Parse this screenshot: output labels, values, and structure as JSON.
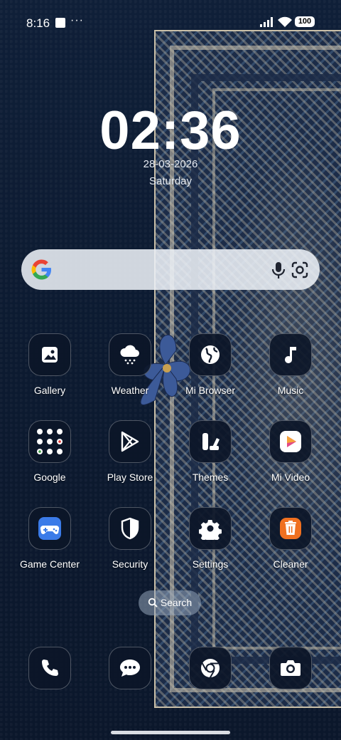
{
  "status_bar": {
    "time": "8:16",
    "more": "···",
    "battery": "100"
  },
  "clock": {
    "time": "02:36",
    "date": "28-03-2026",
    "day": "Saturday"
  },
  "search_widget": {
    "icons": [
      "google-g-icon",
      "microphone-icon",
      "google-lens-icon"
    ]
  },
  "apps": [
    {
      "label": "Gallery",
      "icon": "gallery-icon"
    },
    {
      "label": "Weather",
      "icon": "weather-icon"
    },
    {
      "label": "Mi Browser",
      "icon": "globe-icon"
    },
    {
      "label": "Music",
      "icon": "music-note-icon"
    },
    {
      "label": "Google",
      "icon": "folder-icon"
    },
    {
      "label": "Play Store",
      "icon": "play-store-icon"
    },
    {
      "label": "Themes",
      "icon": "themes-icon"
    },
    {
      "label": "Mi Video",
      "icon": "video-play-icon"
    },
    {
      "label": "Game Center",
      "icon": "gamepad-icon"
    },
    {
      "label": "Security",
      "icon": "shield-icon"
    },
    {
      "label": "Settings",
      "icon": "gear-icon"
    },
    {
      "label": "Cleaner",
      "icon": "trash-icon"
    }
  ],
  "app_search_label": "Search",
  "dock": [
    {
      "icon": "phone-icon"
    },
    {
      "icon": "messages-icon"
    },
    {
      "icon": "chrome-icon"
    },
    {
      "icon": "camera-icon"
    }
  ],
  "colors": {
    "wallpaper": "#0e1d33",
    "rug_beige": "#c9bfa8",
    "cleaner_orange": "#f07020",
    "game_blue": "#3b7be8"
  }
}
